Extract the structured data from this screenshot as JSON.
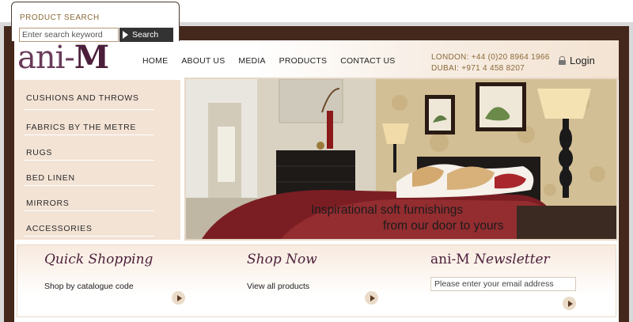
{
  "search": {
    "title": "PRODUCT SEARCH",
    "placeholder": "Enter search keyword",
    "button_label": "Search"
  },
  "logo": {
    "part1": "ani-",
    "part2": "M"
  },
  "nav": [
    {
      "label": "HOME"
    },
    {
      "label": "ABOUT US"
    },
    {
      "label": "MEDIA"
    },
    {
      "label": "PRODUCTS"
    },
    {
      "label": "CONTACT US"
    }
  ],
  "contact": {
    "london": "LONDON: +44 (0)20 8964 1966",
    "dubai": "DUBAI: +971 4 458 8207"
  },
  "login_label": "Login",
  "sidebar": [
    {
      "label": "CUSHIONS AND THROWS"
    },
    {
      "label": "FABRICS BY THE METRE"
    },
    {
      "label": "RUGS"
    },
    {
      "label": "BED LINEN"
    },
    {
      "label": "MIRRORS"
    },
    {
      "label": "ACCESSORIES"
    }
  ],
  "hero": {
    "line1": "Inspirational soft furnishings",
    "line2": "from our door to yours"
  },
  "panels": {
    "quick": {
      "title": "Quick Shopping",
      "link": "Shop by catalogue code"
    },
    "shop": {
      "title": "Shop Now",
      "link": "View all products"
    },
    "newsletter": {
      "title_brand": "ani-M",
      "title_rest": " Newsletter",
      "placeholder": "Please enter your email address"
    }
  },
  "colors": {
    "frame": "#45281c",
    "brand": "#4b1f3a",
    "accent_text": "#8a6a3a",
    "sidebar_bg": "#f3e3d5"
  },
  "icons": [
    "play-triangle-icon",
    "lock-icon",
    "arrow-right-icon"
  ]
}
